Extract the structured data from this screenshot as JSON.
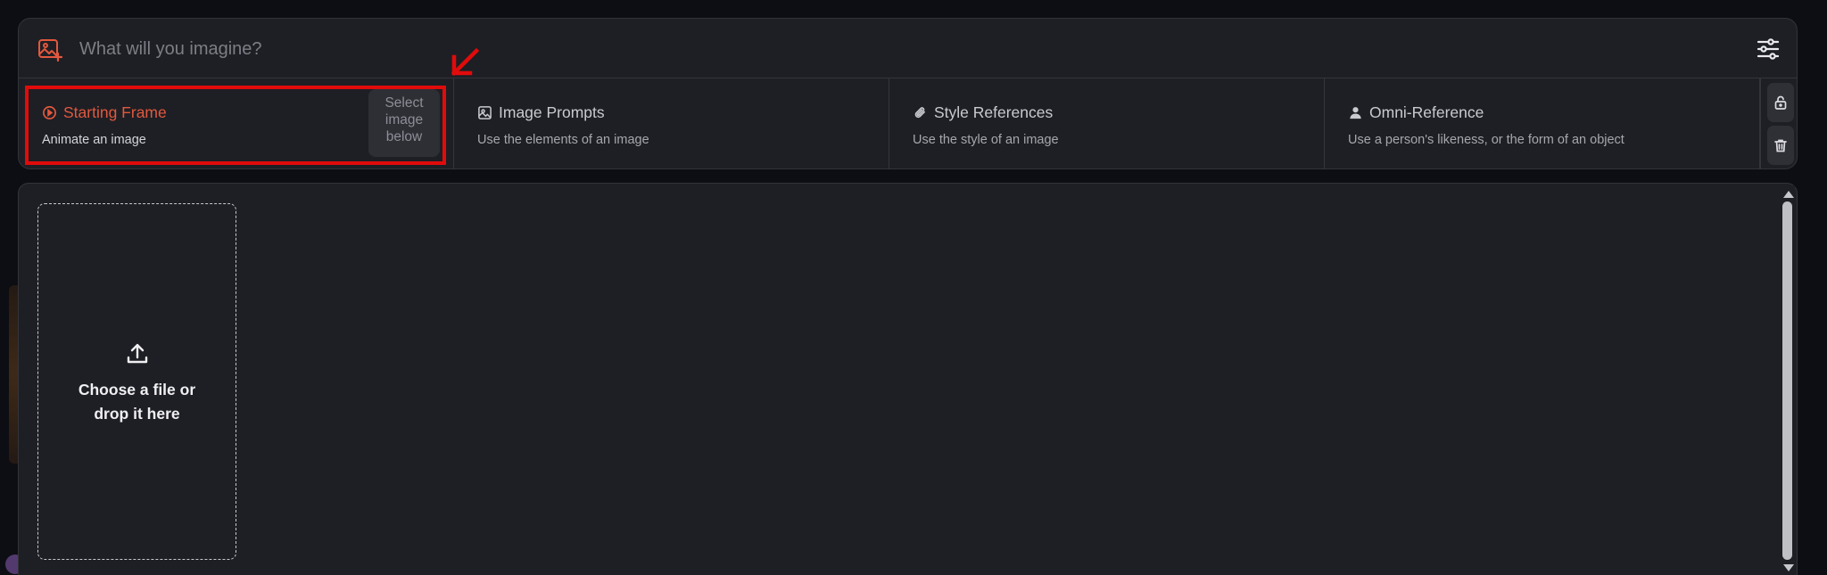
{
  "prompt": {
    "placeholder": "What will you imagine?"
  },
  "options": [
    {
      "title": "Starting Frame",
      "description": "Animate an image",
      "icon": "play-circle-icon",
      "active": true
    },
    {
      "title": "Image Prompts",
      "description": "Use the elements of an image",
      "icon": "image-icon",
      "active": false
    },
    {
      "title": "Style References",
      "description": "Use the style of an image",
      "icon": "paperclip-icon",
      "active": false
    },
    {
      "title": "Omni-Reference",
      "description": "Use a person's likeness, or the form of an object",
      "icon": "person-icon",
      "active": false
    }
  ],
  "starting_frame_badge": "Select image below",
  "dropzone": {
    "line1": "Choose a file or",
    "line2": "drop it here"
  },
  "colors": {
    "accent": "#e2583e",
    "highlight": "#e10b0b",
    "panel": "#1e1f24",
    "background": "#0d0e13"
  }
}
